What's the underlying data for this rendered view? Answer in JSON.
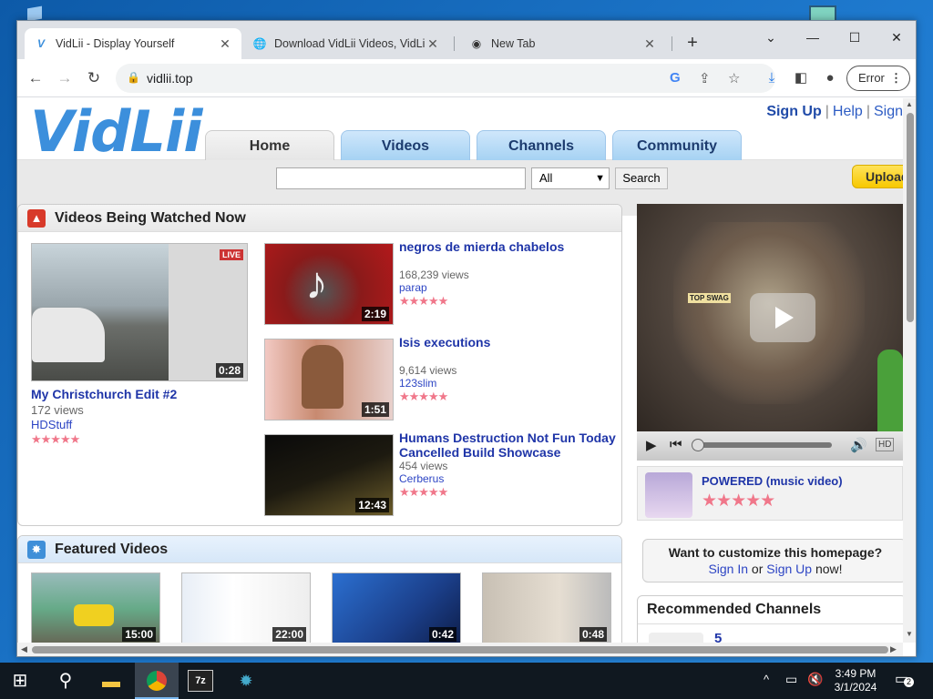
{
  "browser": {
    "tabs": [
      {
        "title": "VidLii - Display Yourself",
        "icon": "vidlii-favicon",
        "active": true
      },
      {
        "title": "Download VidLii Videos, VidLii V",
        "icon": "globe-icon",
        "active": false
      },
      {
        "title": "New Tab",
        "icon": "chrome-icon",
        "active": false
      }
    ],
    "url": "vidlii.top",
    "profile_button": "Error"
  },
  "site": {
    "logo": "VidLii",
    "top_links": {
      "signup": "Sign Up",
      "help": "Help",
      "signin": "Sign"
    },
    "nav": [
      "Home",
      "Videos",
      "Channels",
      "Community"
    ],
    "search": {
      "placeholder": "",
      "scope": "All",
      "button": "Search"
    },
    "upload": "Upload"
  },
  "watched_now": {
    "title": "Videos Being Watched Now",
    "featured": {
      "title": "My Christchurch Edit #2",
      "views": "172 views",
      "user": "HDStuff",
      "duration": "0:28"
    },
    "list": [
      {
        "title": "negros de mierda chabelos",
        "views": "168,239 views",
        "user": "parap",
        "duration": "2:19"
      },
      {
        "title": "Isis executions",
        "views": "9,614 views",
        "user": "123slim",
        "duration": "1:51"
      },
      {
        "title": "Humans Destruction Not Fun Today Cancelled Build Showcase",
        "views": "454 views",
        "user": "Cerberus",
        "duration": "12:43"
      }
    ]
  },
  "featured_videos": {
    "title": "Featured Videos",
    "durations": [
      "15:00",
      "22:00",
      "0:42",
      "0:48"
    ]
  },
  "player": {
    "video_title": "POWERED (music video)",
    "hd_label": "HD",
    "overlay_text": "TOP SWAG"
  },
  "customize": {
    "question": "Want to customize this homepage?",
    "signin": "Sign In",
    "or": " or ",
    "signup": "Sign Up",
    "suffix": " now!"
  },
  "recommended": {
    "title": "Recommended Channels",
    "first_count": "5"
  },
  "stars": "★★★★★",
  "taskbar": {
    "time": "3:49 PM",
    "date": "3/1/2024",
    "notifications": "2"
  },
  "colors": {
    "link_blue": "#1f35a8",
    "star_pink": "#f0778a",
    "logo_blue": "#3c8fdc",
    "upload_yellow": "#f7c800"
  }
}
